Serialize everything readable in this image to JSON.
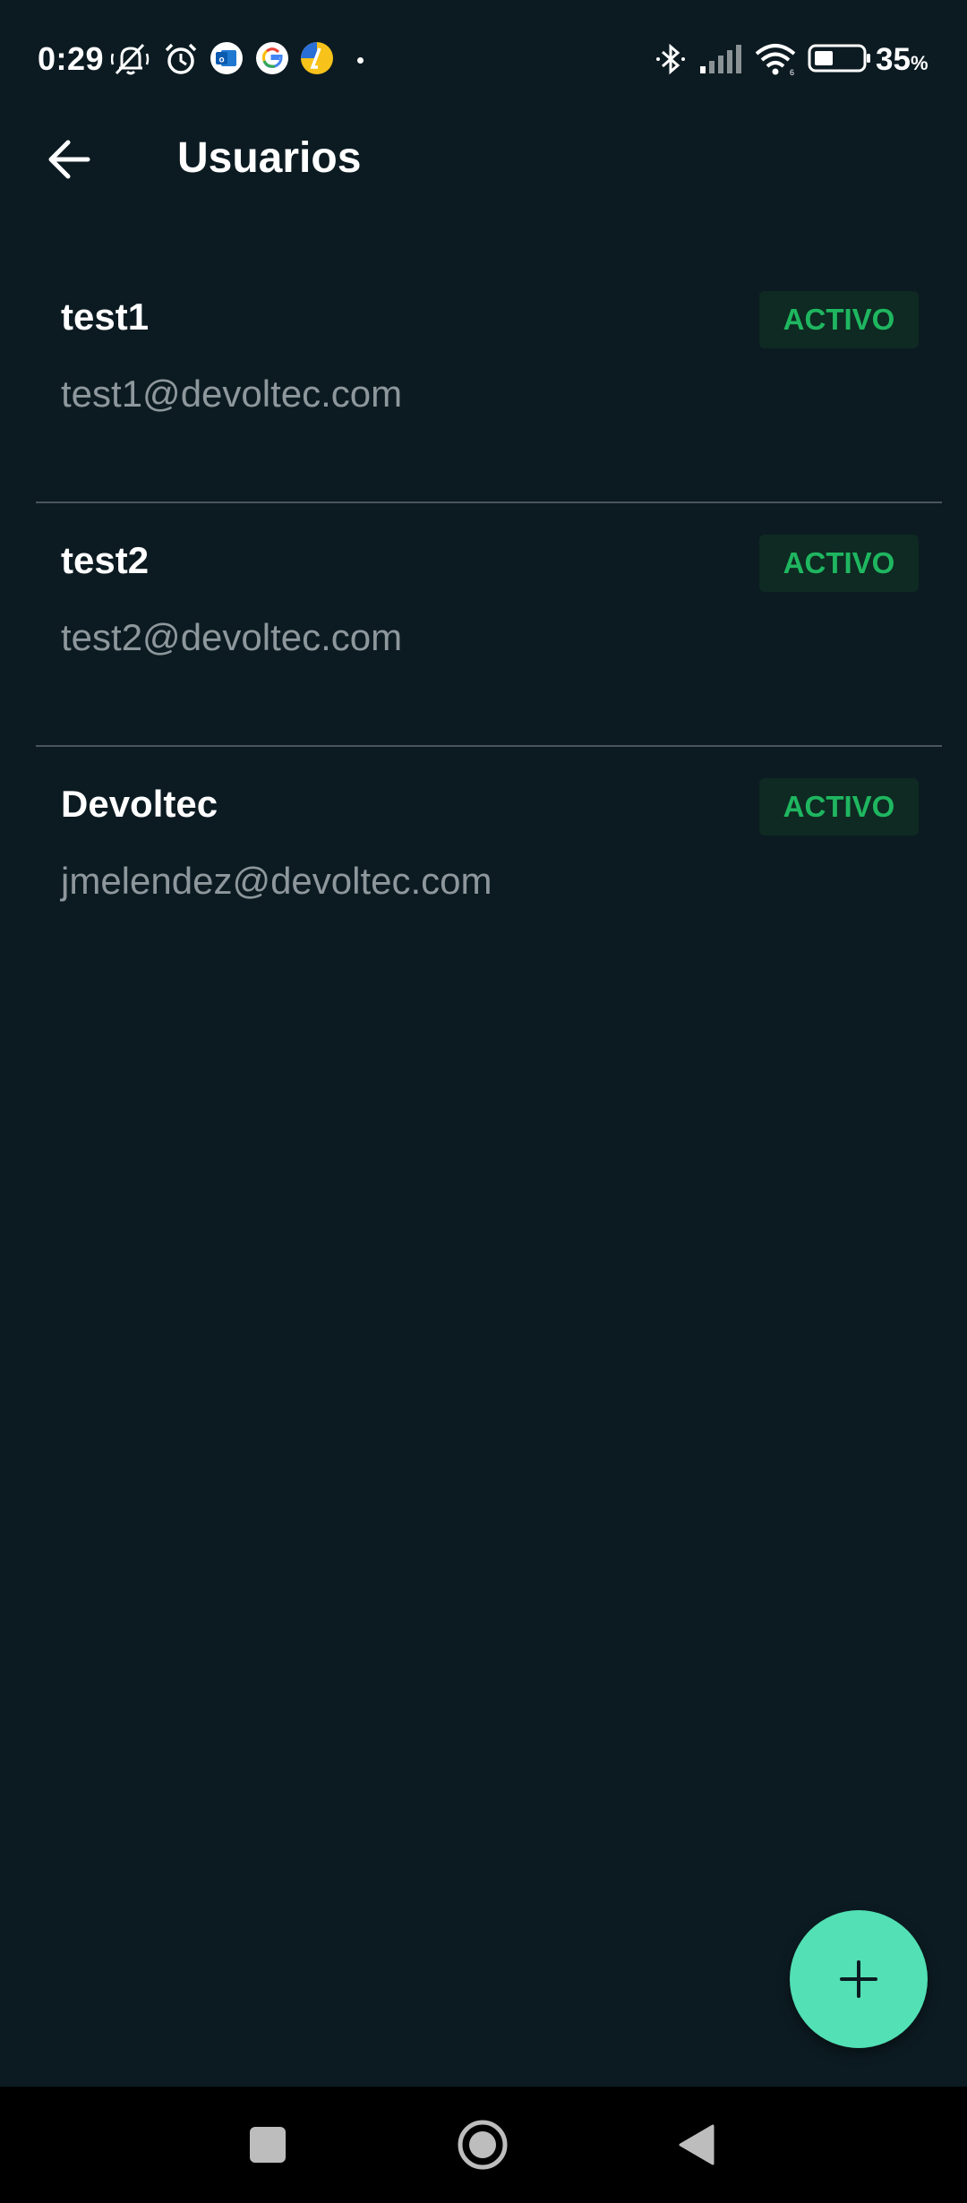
{
  "status_bar": {
    "time": "0:29",
    "battery_percent": "35",
    "battery_unit": "%",
    "icons": [
      "silent-bell-icon",
      "alarm-icon",
      "outlook-icon",
      "google-icon",
      "app-icon",
      "bluetooth-icon",
      "signal-icon",
      "wifi-icon",
      "battery-icon"
    ]
  },
  "app_bar": {
    "title": "Usuarios",
    "back_icon": "arrow-left-icon"
  },
  "users": [
    {
      "name": "test1",
      "email": "test1@devoltec.com",
      "status": "ACTIVO"
    },
    {
      "name": "test2",
      "email": "test2@devoltec.com",
      "status": "ACTIVO"
    },
    {
      "name": "Devoltec",
      "email": "jmelendez@devoltec.com",
      "status": "ACTIVO"
    }
  ],
  "fab": {
    "icon": "plus-icon"
  },
  "nav_bar": {
    "icons": [
      "recents-square-icon",
      "home-circle-icon",
      "back-triangle-icon"
    ]
  },
  "colors": {
    "background": "#0c1b22",
    "badge_bg": "#0e2a22",
    "badge_text": "#1fb660",
    "fab": "#52e0b4",
    "divider": "#4a565c",
    "email_text": "#8d979c"
  }
}
